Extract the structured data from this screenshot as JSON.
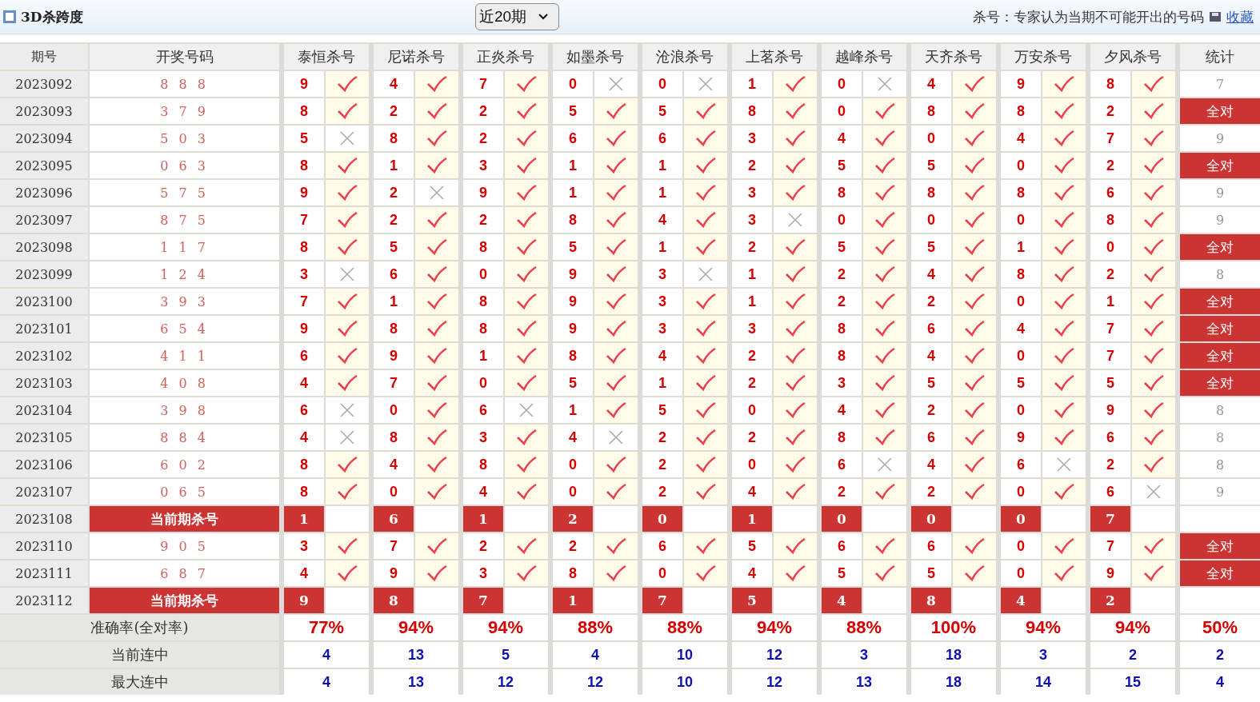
{
  "header": {
    "title": "3D杀跨度",
    "period_select": {
      "value": "近20期"
    },
    "note": "杀号：专家认为当期不可能开出的号码",
    "bookmark": "收藏"
  },
  "columns": {
    "period": "期号",
    "draw": "开奖号码",
    "experts": [
      "泰恒杀号",
      "尼诺杀号",
      "正炎杀号",
      "如墨杀号",
      "沧浪杀号",
      "上茗杀号",
      "越峰杀号",
      "天齐杀号",
      "万安杀号",
      "夕风杀号"
    ],
    "stat": "统计"
  },
  "rows": [
    {
      "period": "2023092",
      "kind": "result",
      "draw": "8 8 8",
      "kills": [
        "9",
        "4",
        "7",
        "0",
        "0",
        "1",
        "0",
        "4",
        "9",
        "8"
      ],
      "hits": [
        true,
        true,
        true,
        false,
        false,
        true,
        false,
        true,
        true,
        true
      ],
      "stat": "7",
      "all_hit": false
    },
    {
      "period": "2023093",
      "kind": "result",
      "draw": "3 7 9",
      "kills": [
        "8",
        "2",
        "2",
        "5",
        "5",
        "8",
        "0",
        "8",
        "8",
        "2"
      ],
      "hits": [
        true,
        true,
        true,
        true,
        true,
        true,
        true,
        true,
        true,
        true
      ],
      "stat": "全对",
      "all_hit": true
    },
    {
      "period": "2023094",
      "kind": "result",
      "draw": "5 0 3",
      "kills": [
        "5",
        "8",
        "2",
        "6",
        "6",
        "3",
        "4",
        "0",
        "4",
        "7"
      ],
      "hits": [
        false,
        true,
        true,
        true,
        true,
        true,
        true,
        true,
        true,
        true
      ],
      "stat": "9",
      "all_hit": false
    },
    {
      "period": "2023095",
      "kind": "result",
      "draw": "0 6 3",
      "kills": [
        "8",
        "1",
        "3",
        "1",
        "1",
        "2",
        "5",
        "5",
        "0",
        "2"
      ],
      "hits": [
        true,
        true,
        true,
        true,
        true,
        true,
        true,
        true,
        true,
        true
      ],
      "stat": "全对",
      "all_hit": true
    },
    {
      "period": "2023096",
      "kind": "result",
      "draw": "5 7 5",
      "kills": [
        "9",
        "2",
        "9",
        "1",
        "1",
        "3",
        "8",
        "8",
        "8",
        "6"
      ],
      "hits": [
        true,
        false,
        true,
        true,
        true,
        true,
        true,
        true,
        true,
        true
      ],
      "stat": "9",
      "all_hit": false
    },
    {
      "period": "2023097",
      "kind": "result",
      "draw": "8 7 5",
      "kills": [
        "7",
        "2",
        "2",
        "8",
        "4",
        "3",
        "0",
        "0",
        "0",
        "8"
      ],
      "hits": [
        true,
        true,
        true,
        true,
        true,
        false,
        true,
        true,
        true,
        true
      ],
      "stat": "9",
      "all_hit": false
    },
    {
      "period": "2023098",
      "kind": "result",
      "draw": "1 1 7",
      "kills": [
        "8",
        "5",
        "8",
        "5",
        "1",
        "2",
        "5",
        "5",
        "1",
        "0"
      ],
      "hits": [
        true,
        true,
        true,
        true,
        true,
        true,
        true,
        true,
        true,
        true
      ],
      "stat": "全对",
      "all_hit": true
    },
    {
      "period": "2023099",
      "kind": "result",
      "draw": "1 2 4",
      "kills": [
        "3",
        "6",
        "0",
        "9",
        "3",
        "1",
        "2",
        "4",
        "8",
        "2"
      ],
      "hits": [
        false,
        true,
        true,
        true,
        false,
        true,
        true,
        true,
        true,
        true
      ],
      "stat": "8",
      "all_hit": false
    },
    {
      "period": "2023100",
      "kind": "result",
      "draw": "3 9 3",
      "kills": [
        "7",
        "1",
        "8",
        "9",
        "3",
        "1",
        "2",
        "2",
        "0",
        "1"
      ],
      "hits": [
        true,
        true,
        true,
        true,
        true,
        true,
        true,
        true,
        true,
        true
      ],
      "stat": "全对",
      "all_hit": true
    },
    {
      "period": "2023101",
      "kind": "result",
      "draw": "6 5 4",
      "kills": [
        "9",
        "8",
        "8",
        "9",
        "3",
        "3",
        "8",
        "6",
        "4",
        "7"
      ],
      "hits": [
        true,
        true,
        true,
        true,
        true,
        true,
        true,
        true,
        true,
        true
      ],
      "stat": "全对",
      "all_hit": true
    },
    {
      "period": "2023102",
      "kind": "result",
      "draw": "4 1 1",
      "kills": [
        "6",
        "9",
        "1",
        "8",
        "4",
        "2",
        "8",
        "4",
        "0",
        "7"
      ],
      "hits": [
        true,
        true,
        true,
        true,
        true,
        true,
        true,
        true,
        true,
        true
      ],
      "stat": "全对",
      "all_hit": true
    },
    {
      "period": "2023103",
      "kind": "result",
      "draw": "4 0 8",
      "kills": [
        "4",
        "7",
        "0",
        "5",
        "1",
        "2",
        "3",
        "5",
        "5",
        "5"
      ],
      "hits": [
        true,
        true,
        true,
        true,
        true,
        true,
        true,
        true,
        true,
        true
      ],
      "stat": "全对",
      "all_hit": true
    },
    {
      "period": "2023104",
      "kind": "result",
      "draw": "3 9 8",
      "kills": [
        "6",
        "0",
        "6",
        "1",
        "5",
        "0",
        "4",
        "2",
        "0",
        "9"
      ],
      "hits": [
        false,
        true,
        false,
        true,
        true,
        true,
        true,
        true,
        true,
        true
      ],
      "stat": "8",
      "all_hit": false
    },
    {
      "period": "2023105",
      "kind": "result",
      "draw": "8 8 4",
      "kills": [
        "4",
        "8",
        "3",
        "4",
        "2",
        "2",
        "8",
        "6",
        "9",
        "6"
      ],
      "hits": [
        false,
        true,
        true,
        false,
        true,
        true,
        true,
        true,
        true,
        true
      ],
      "stat": "8",
      "all_hit": false
    },
    {
      "period": "2023106",
      "kind": "result",
      "draw": "6 0 2",
      "kills": [
        "8",
        "4",
        "8",
        "0",
        "2",
        "0",
        "6",
        "4",
        "6",
        "2"
      ],
      "hits": [
        true,
        true,
        true,
        true,
        true,
        true,
        false,
        true,
        false,
        true
      ],
      "stat": "8",
      "all_hit": false
    },
    {
      "period": "2023107",
      "kind": "result",
      "draw": "0 6 5",
      "kills": [
        "8",
        "0",
        "4",
        "0",
        "2",
        "4",
        "2",
        "2",
        "0",
        "6"
      ],
      "hits": [
        true,
        true,
        true,
        true,
        true,
        true,
        true,
        true,
        true,
        false
      ],
      "stat": "9",
      "all_hit": false
    },
    {
      "period": "2023108",
      "kind": "current",
      "draw": "当前期杀号",
      "kills": [
        "1",
        "6",
        "1",
        "2",
        "0",
        "1",
        "0",
        "0",
        "0",
        "7"
      ]
    },
    {
      "period": "2023110",
      "kind": "result",
      "draw": "9 0 5",
      "kills": [
        "3",
        "7",
        "2",
        "2",
        "6",
        "5",
        "6",
        "6",
        "0",
        "7"
      ],
      "hits": [
        true,
        true,
        true,
        true,
        true,
        true,
        true,
        true,
        true,
        true
      ],
      "stat": "全对",
      "all_hit": true
    },
    {
      "period": "2023111",
      "kind": "result",
      "draw": "6 8 7",
      "kills": [
        "4",
        "9",
        "3",
        "8",
        "0",
        "4",
        "5",
        "5",
        "0",
        "9"
      ],
      "hits": [
        true,
        true,
        true,
        true,
        true,
        true,
        true,
        true,
        true,
        true
      ],
      "stat": "全对",
      "all_hit": true
    },
    {
      "period": "2023112",
      "kind": "current",
      "draw": "当前期杀号",
      "kills": [
        "9",
        "8",
        "7",
        "1",
        "7",
        "5",
        "4",
        "8",
        "4",
        "2"
      ]
    }
  ],
  "summary": [
    {
      "kind": "rate",
      "label": "准确率(全对率)",
      "values": [
        "77%",
        "94%",
        "94%",
        "88%",
        "88%",
        "94%",
        "88%",
        "100%",
        "94%",
        "94%"
      ],
      "stat": "50%"
    },
    {
      "kind": "streak",
      "label": "当前连中",
      "values": [
        "4",
        "13",
        "5",
        "4",
        "10",
        "12",
        "3",
        "18",
        "3",
        "2"
      ],
      "stat": "2"
    },
    {
      "kind": "streak",
      "label": "最大连中",
      "values": [
        "4",
        "13",
        "12",
        "12",
        "10",
        "12",
        "13",
        "18",
        "14",
        "15"
      ],
      "stat": "4"
    }
  ]
}
